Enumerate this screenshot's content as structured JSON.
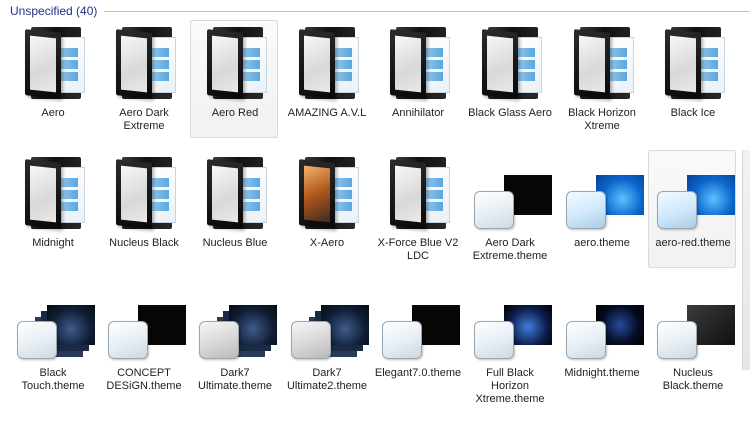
{
  "group": {
    "title": "Unspecified (40)"
  },
  "rows": [
    {
      "items": [
        {
          "label": "Aero",
          "kind": "folder",
          "icon": "folder-icon"
        },
        {
          "label": "Aero Dark Extreme",
          "kind": "folder",
          "icon": "folder-icon"
        },
        {
          "label": "Aero Red",
          "kind": "folder",
          "icon": "folder-icon",
          "selected": true
        },
        {
          "label": "AMAZING A.V.L",
          "kind": "folder",
          "icon": "folder-icon"
        },
        {
          "label": "Annihilator",
          "kind": "folder",
          "icon": "folder-icon"
        },
        {
          "label": "Black Glass Aero",
          "kind": "folder",
          "icon": "folder-icon"
        },
        {
          "label": "Black Horizon Xtreme",
          "kind": "folder",
          "icon": "folder-icon"
        },
        {
          "label": "Black Ice",
          "kind": "folder",
          "icon": "folder-icon"
        }
      ]
    },
    {
      "items": [
        {
          "label": "Midnight",
          "kind": "folder",
          "icon": "folder-icon"
        },
        {
          "label": "Nucleus Black",
          "kind": "folder",
          "icon": "folder-icon"
        },
        {
          "label": "Nucleus Blue",
          "kind": "folder",
          "icon": "folder-icon"
        },
        {
          "label": "X-Aero",
          "kind": "folder",
          "icon": "folder-icon",
          "variant": "orange"
        },
        {
          "label": "X-Force Blue V2 LDC",
          "kind": "folder",
          "icon": "folder-icon"
        },
        {
          "label": "Aero Dark Extreme.theme",
          "kind": "theme",
          "icon": "theme-file-icon",
          "shot": "dark"
        },
        {
          "label": "aero.theme",
          "kind": "theme",
          "icon": "theme-file-icon",
          "shot": "win",
          "square": "blueish"
        },
        {
          "label": "aero-red.theme",
          "kind": "theme",
          "icon": "theme-file-icon",
          "shot": "win",
          "square": "blueish",
          "selected": true
        }
      ]
    },
    {
      "items": [
        {
          "label": "Black Touch.theme",
          "kind": "theme",
          "icon": "theme-file-icon",
          "shot": "stack"
        },
        {
          "label": "CONCEPT DESiGN.theme",
          "kind": "theme",
          "icon": "theme-file-icon",
          "shot": "dark"
        },
        {
          "label": "Dark7 Ultimate.theme",
          "kind": "theme",
          "icon": "theme-file-icon",
          "shot": "stack",
          "square": "greyish"
        },
        {
          "label": "Dark7 Ultimate2.theme",
          "kind": "theme",
          "icon": "theme-file-icon",
          "shot": "stack",
          "square": "greyish"
        },
        {
          "label": "Elegant7.0.theme",
          "kind": "theme",
          "icon": "theme-file-icon",
          "shot": "dark"
        },
        {
          "label": "Full Black Horizon Xtreme.theme",
          "kind": "theme",
          "icon": "theme-file-icon",
          "shot": "blue"
        },
        {
          "label": "Midnight.theme",
          "kind": "theme",
          "icon": "theme-file-icon",
          "shot": "navy"
        },
        {
          "label": "Nucleus Black.theme",
          "kind": "theme",
          "icon": "theme-file-icon",
          "shot": "grey"
        }
      ]
    }
  ]
}
